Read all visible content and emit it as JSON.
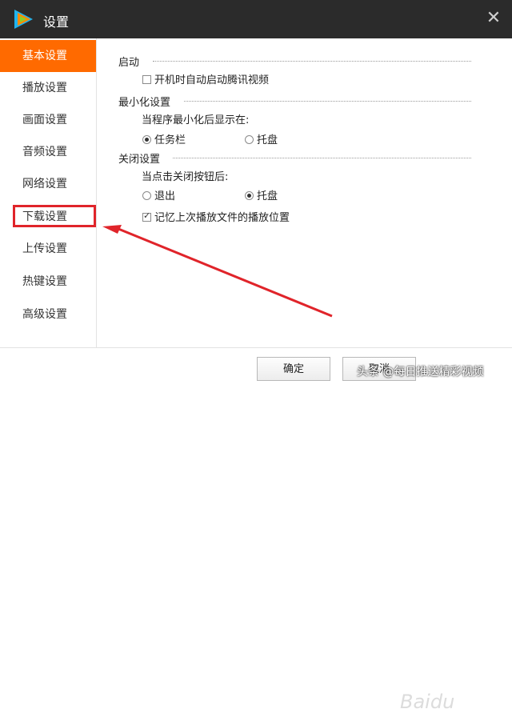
{
  "window": {
    "title": "设置"
  },
  "sidebar": {
    "items": [
      {
        "label": "基本设置",
        "active": true
      },
      {
        "label": "播放设置"
      },
      {
        "label": "画面设置"
      },
      {
        "label": "音频设置"
      },
      {
        "label": "网络设置"
      },
      {
        "label": "下载设置",
        "highlighted": true
      },
      {
        "label": "上传设置"
      },
      {
        "label": "热键设置"
      },
      {
        "label": "高级设置"
      }
    ]
  },
  "main": {
    "startup": {
      "heading": "启动",
      "autostart_label": "开机时自动启动腾讯视频",
      "autostart_checked": false
    },
    "minimize": {
      "heading": "最小化设置",
      "prompt": "当程序最小化后显示在:",
      "option_taskbar": "任务栏",
      "option_tray": "托盘",
      "selected": "任务栏"
    },
    "close": {
      "heading": "关闭设置",
      "prompt": "当点击关闭按钮后:",
      "option_exit": "退出",
      "option_tray": "托盘",
      "selected": "托盘"
    },
    "remember_label": "记忆上次播放文件的播放位置",
    "remember_checked": true
  },
  "footer": {
    "ok_label": "确定",
    "cancel_label": "取消"
  },
  "overlay": {
    "watermark": "头条 @每日推送精彩视频",
    "baidu_mark": "Baidu"
  },
  "colors": {
    "accent": "#ff6a00",
    "titlebar": "#2b2b2b",
    "annotation": "#e0242a"
  }
}
